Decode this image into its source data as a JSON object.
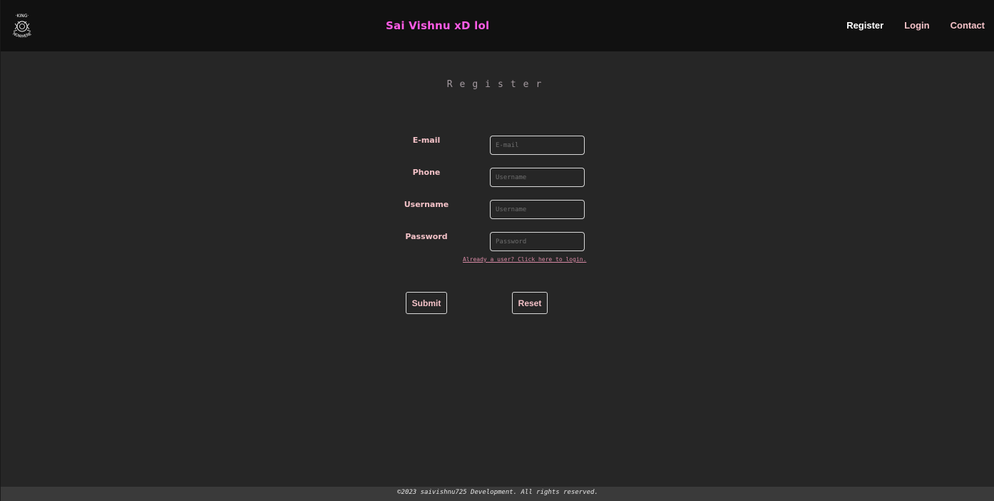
{
  "header": {
    "logo_top_text": "·KING·",
    "logo_bottom_text": "NOWHERE",
    "site_title": "Sai Vishnu xD lol",
    "nav": {
      "register": "Register",
      "login": "Login",
      "contact": "Contact"
    }
  },
  "form": {
    "heading": "Register",
    "fields": [
      {
        "label": "E-mail",
        "placeholder": "E-mail",
        "value": ""
      },
      {
        "label": "Phone",
        "placeholder": "Username",
        "value": ""
      },
      {
        "label": "Username",
        "placeholder": "Username",
        "value": ""
      },
      {
        "label": "Password",
        "placeholder": "Password",
        "value": ""
      }
    ],
    "login_link": "Already a user? Click here to login.",
    "submit_label": "Submit",
    "reset_label": "Reset"
  },
  "footer": {
    "text": "©2023 saivishnu725 Development. All rights reserved."
  },
  "colors": {
    "title_accent": "#ff5ce6",
    "label_pink": "#f4c2c8",
    "page_background": "#262626",
    "navbar_background": "#111111"
  }
}
